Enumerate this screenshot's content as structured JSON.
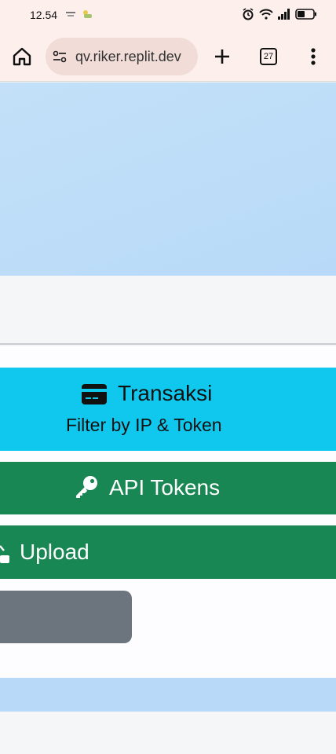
{
  "status_bar": {
    "time": "12.54",
    "icons": [
      "alarm-icon",
      "wifi-icon",
      "signal-icon",
      "battery-icon"
    ]
  },
  "browser": {
    "url": "qv.riker.replit.dev",
    "tab_count": "27",
    "icons": [
      "home-icon",
      "site-settings-icon",
      "new-tab-icon",
      "tabs-icon",
      "more-menu-icon"
    ]
  },
  "menu": {
    "transaksi": {
      "title": "Transaksi",
      "subtitle": "Filter by IP & Token",
      "icon": "credit-card-icon",
      "color": "#10c8ee"
    },
    "api_tokens": {
      "title": "API Tokens",
      "icon": "key-icon",
      "color": "#198754"
    },
    "upload": {
      "title": "Upload",
      "icon": "upload-icon",
      "color": "#198754"
    }
  },
  "colors": {
    "hero": "#bcdcf8",
    "secondary_button": "#6c757d",
    "browser_chrome": "#fdf0ec"
  }
}
